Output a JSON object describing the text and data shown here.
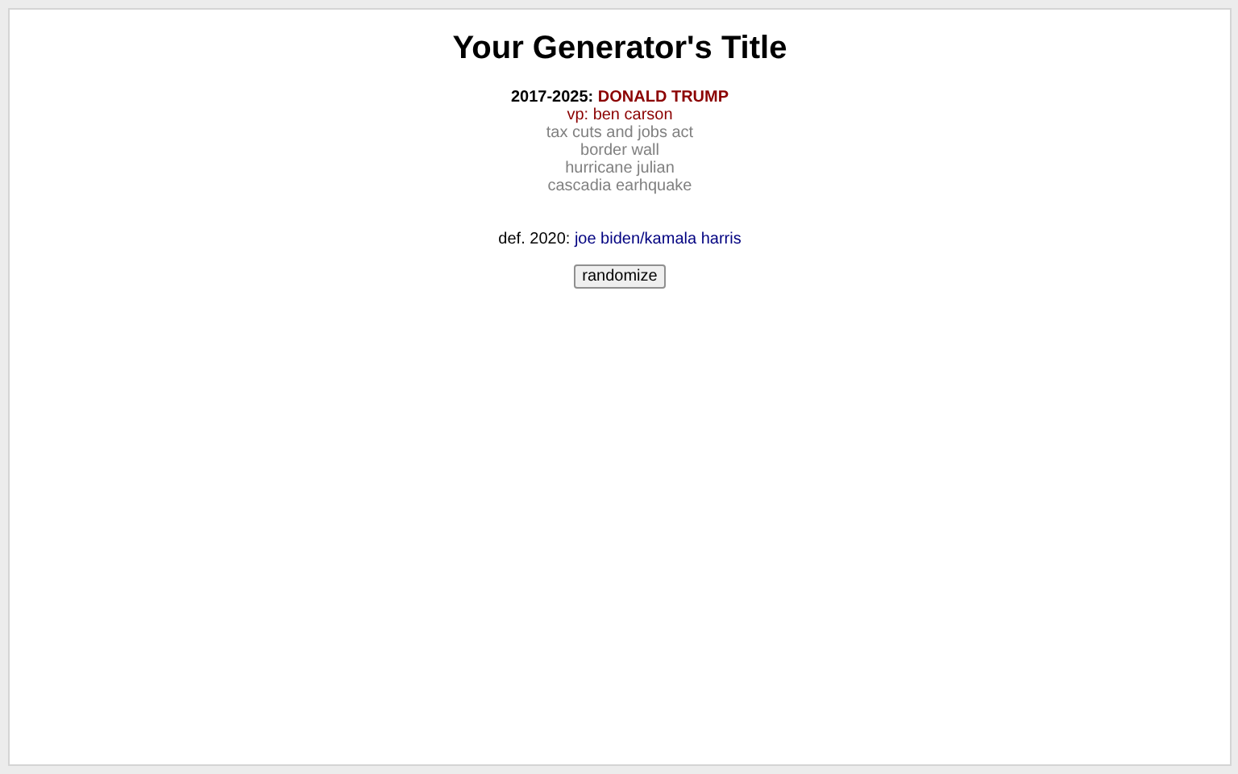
{
  "title": "Your Generator's Title",
  "term": {
    "years": "2017-2025:",
    "president": "DONALD TRUMP",
    "color": "#8b0000"
  },
  "vp": {
    "label": "vp:",
    "name": "ben carson",
    "color": "#8b0000"
  },
  "events": [
    "tax cuts and jobs act",
    "border wall",
    "hurricane julian",
    "cascadia earhquake"
  ],
  "defeated": {
    "label": "def. 2020:",
    "name": "joe biden/kamala harris",
    "color": "#000080"
  },
  "button": "randomize"
}
